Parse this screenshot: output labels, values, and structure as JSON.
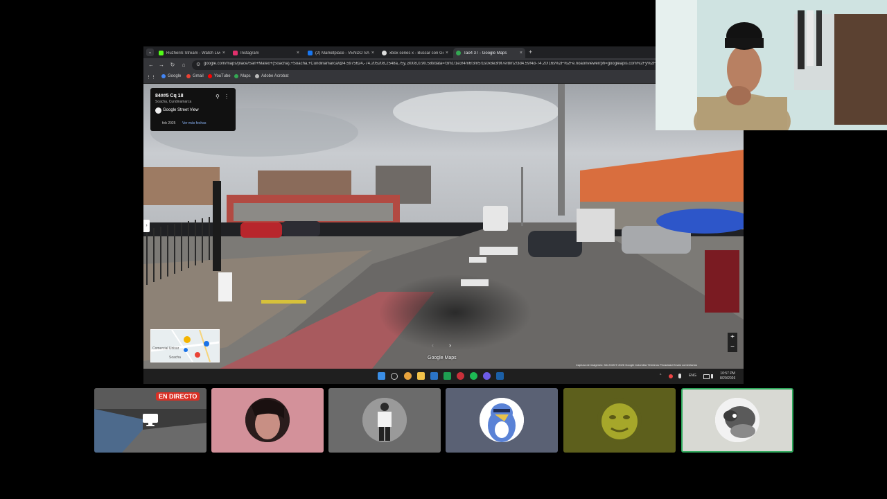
{
  "browser": {
    "tabs": [
      {
        "label": "RuzheriS Stream - Watch Live o",
        "favicon_color": "#53fc18",
        "active": false
      },
      {
        "label": "Instagram",
        "favicon_color": "#e1306c",
        "active": false
      },
      {
        "label": "(2) Marketplace - VENDO SAN",
        "favicon_color": "#1877f2",
        "active": false
      },
      {
        "label": "xbox series x - Buscar con Goo",
        "favicon_color": "#dddddd",
        "active": false
      },
      {
        "label": "Tao4 37 - Google Maps",
        "favicon_color": "#34a853",
        "active": true
      }
    ],
    "tab_close": "×",
    "new_tab": "+",
    "tab_menu": "⌄",
    "nav": {
      "back": "←",
      "forward": "→",
      "reload": "↻",
      "home": "⌂"
    },
    "url": "google.com/maps/place/San+Mateo+(Soacha),+Soacha,+Cundinamarca/@4.5975624,-74.205208,2548a,75y,,8008,0,90.58t/data=!3m1!1e3!4m6!3m5!1s0x8e3f9f7e!8m2!3d4.59!4d-74.20!16s%2F%2Fe.noaonviewer/ph=googleapis.com%2Fy%2Fxi",
    "bookmarks": [
      {
        "label": "Google",
        "color": "#4285f4"
      },
      {
        "label": "Gmail",
        "color": "#ea4335"
      },
      {
        "label": "YouTube",
        "color": "#ff0000"
      },
      {
        "label": "Maps",
        "color": "#34a853"
      },
      {
        "label": "Adobe Acrobat",
        "color": "#bbbbbb"
      }
    ]
  },
  "streetview": {
    "card_title": "84##5 Cq 18",
    "card_subtitle": "Soacha, Cundinamarca",
    "card_service": "Google Street View",
    "card_date": "feb 2025",
    "card_more": "Ver más fechas",
    "collapse_glyph": "›",
    "logo": "Google Maps",
    "nav_next": "›",
    "nav_prev": "‹",
    "credits": "Captura de imágenes: feb 2025   © 2026 Google   Colombia   Términos   Privacidad   Enviar comentarios",
    "zoom_in": "+",
    "zoom_out": "−",
    "minimap_label1": "Comercial Unisur",
    "minimap_label2": "Soacha"
  },
  "taskbar": {
    "lang": "ENG",
    "time": "10:57 PM",
    "date": "8/29/2026",
    "tray_arrow": "^"
  },
  "call": {
    "live_badge": "EN DIRECTO",
    "participant_colors": [
      "#2c2c2c",
      "#d3919a",
      "#6b6b6b",
      "#5a6174",
      "#5d5f1c",
      "#d8d9d3"
    ]
  }
}
